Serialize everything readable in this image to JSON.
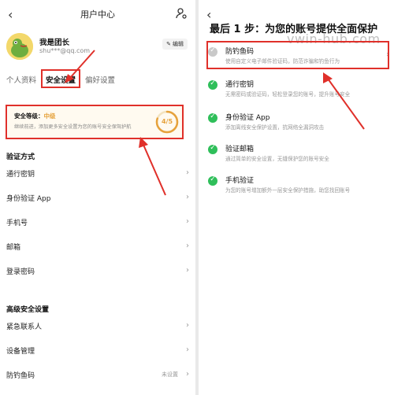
{
  "left": {
    "nav_title": "用户中心",
    "back_glyph": "‹",
    "profile": {
      "name": "我是团长",
      "email": "shu***@qq.com",
      "edit_label": "编辑"
    },
    "tabs": [
      {
        "label": "个人资料"
      },
      {
        "label": "安全设置"
      },
      {
        "label": "偏好设置"
      }
    ],
    "security_card": {
      "level_label": "安全等级：",
      "level_value": "中级",
      "description": "继续前进，添加更多安全设置为您的账号安全保驾护航",
      "score": "4/5"
    },
    "section1": {
      "title": "验证方式",
      "items": [
        {
          "label": "通行密钥",
          "value": ""
        },
        {
          "label": "身份验证 App",
          "value": ""
        },
        {
          "label": "手机号",
          "value": ""
        },
        {
          "label": "邮箱",
          "value": ""
        },
        {
          "label": "登录密码",
          "value": ""
        }
      ]
    },
    "section2": {
      "title": "高级安全设置",
      "items": [
        {
          "label": "紧急联系人",
          "value": ""
        },
        {
          "label": "设备管理",
          "value": ""
        },
        {
          "label": "防钓鱼码",
          "value": "未设置"
        }
      ]
    }
  },
  "right": {
    "back_glyph": "‹",
    "title": "最后 1 步：为您的账号提供全面保护",
    "watermark": "vwin-hub.com",
    "options": [
      {
        "title": "防钓鱼码",
        "desc": "使用自定义电子邮件验证码，防范诈骗和钓鱼行为",
        "status": "pending"
      },
      {
        "title": "通行密钥",
        "desc": "无需密码或验证码，轻松登录您的账号，提升账号安全",
        "status": "done"
      },
      {
        "title": "身份验证 App",
        "desc": "添加离线安全保护设置，抗网络全漏洞攻击",
        "status": "done"
      },
      {
        "title": "验证邮箱",
        "desc": "通过简单的安全设置，无缝保护您的账号安全",
        "status": "done"
      },
      {
        "title": "手机验证",
        "desc": "为您的账号增加额外一层安全保护措施，助您找回账号",
        "status": "done"
      }
    ]
  },
  "colors": {
    "highlight_red": "#e0302a",
    "level_orange": "#e6a23c",
    "check_green": "#2fbf5a"
  }
}
